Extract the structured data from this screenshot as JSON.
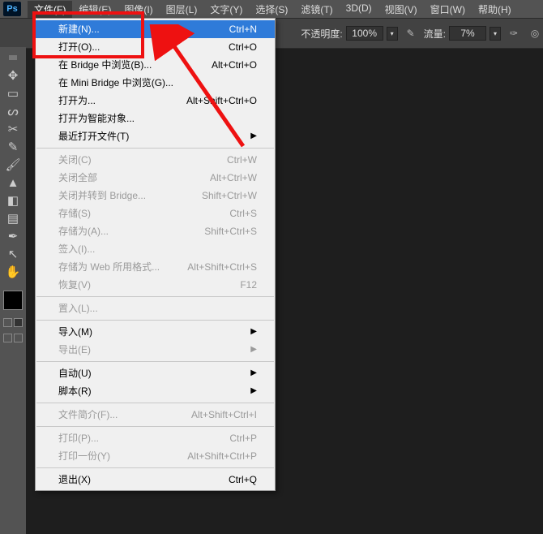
{
  "menubar": {
    "items": [
      "文件(F)",
      "编辑(E)",
      "图像(I)",
      "图层(L)",
      "文字(Y)",
      "选择(S)",
      "滤镜(T)",
      "3D(D)",
      "视图(V)",
      "窗口(W)",
      "帮助(H)"
    ],
    "active_index": 0
  },
  "optionsbar": {
    "opacity_label": "不透明度:",
    "opacity_val": "100%",
    "flow_label": "流量:",
    "flow_val": "7%"
  },
  "tools": [
    {
      "name": "move-tool",
      "glyph": "✥"
    },
    {
      "name": "marquee-tool",
      "glyph": "▭"
    },
    {
      "name": "lasso-tool",
      "glyph": "ᔕ"
    },
    {
      "name": "crop-tool",
      "glyph": "✂"
    },
    {
      "name": "eyedropper-tool",
      "glyph": "✎"
    },
    {
      "name": "brush-tool",
      "glyph": "🖌"
    },
    {
      "name": "stamp-tool",
      "glyph": "▲"
    },
    {
      "name": "eraser-tool",
      "glyph": "◧"
    },
    {
      "name": "gradient-tool",
      "glyph": "▤"
    },
    {
      "name": "pen-tool",
      "glyph": "✒"
    },
    {
      "name": "path-select-tool",
      "glyph": "↖"
    },
    {
      "name": "hand-tool",
      "glyph": "✋"
    }
  ],
  "menu_items": [
    {
      "label": "新建(N)...",
      "shortcut": "Ctrl+N",
      "highlight": true
    },
    {
      "label": "打开(O)...",
      "shortcut": "Ctrl+O"
    },
    {
      "label": "在 Bridge 中浏览(B)...",
      "shortcut": "Alt+Ctrl+O"
    },
    {
      "label": "在 Mini Bridge 中浏览(G)..."
    },
    {
      "label": "打开为...",
      "shortcut": "Alt+Shift+Ctrl+O"
    },
    {
      "label": "打开为智能对象..."
    },
    {
      "label": "最近打开文件(T)",
      "submenu": true
    },
    {
      "sep": true
    },
    {
      "label": "关闭(C)",
      "shortcut": "Ctrl+W",
      "disabled": true
    },
    {
      "label": "关闭全部",
      "shortcut": "Alt+Ctrl+W",
      "disabled": true
    },
    {
      "label": "关闭并转到 Bridge...",
      "shortcut": "Shift+Ctrl+W",
      "disabled": true
    },
    {
      "label": "存储(S)",
      "shortcut": "Ctrl+S",
      "disabled": true
    },
    {
      "label": "存储为(A)...",
      "shortcut": "Shift+Ctrl+S",
      "disabled": true
    },
    {
      "label": "签入(I)...",
      "disabled": true
    },
    {
      "label": "存储为 Web 所用格式...",
      "shortcut": "Alt+Shift+Ctrl+S",
      "disabled": true
    },
    {
      "label": "恢复(V)",
      "shortcut": "F12",
      "disabled": true
    },
    {
      "sep": true
    },
    {
      "label": "置入(L)...",
      "disabled": true
    },
    {
      "sep": true
    },
    {
      "label": "导入(M)",
      "submenu": true
    },
    {
      "label": "导出(E)",
      "submenu": true,
      "disabled": true
    },
    {
      "sep": true
    },
    {
      "label": "自动(U)",
      "submenu": true
    },
    {
      "label": "脚本(R)",
      "submenu": true
    },
    {
      "sep": true
    },
    {
      "label": "文件简介(F)...",
      "shortcut": "Alt+Shift+Ctrl+I",
      "disabled": true
    },
    {
      "sep": true
    },
    {
      "label": "打印(P)...",
      "shortcut": "Ctrl+P",
      "disabled": true
    },
    {
      "label": "打印一份(Y)",
      "shortcut": "Alt+Shift+Ctrl+P",
      "disabled": true
    },
    {
      "sep": true
    },
    {
      "label": "退出(X)",
      "shortcut": "Ctrl+Q"
    }
  ]
}
